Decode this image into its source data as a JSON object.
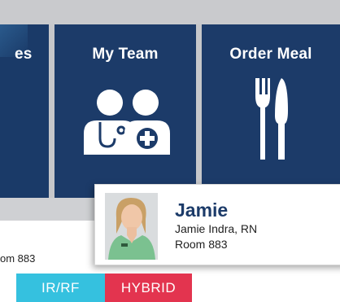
{
  "tiles": {
    "left_partial_label": "es",
    "team_label": "My Team",
    "meal_label": "Order Meal"
  },
  "left_panel": {
    "room_partial": "om 883"
  },
  "card": {
    "name": "Jamie",
    "full_name": "Jamie Indra, RN",
    "room": "Room 883"
  },
  "buttons": {
    "irrf_label": "IR/RF",
    "hybrid_label": "HYBRID"
  },
  "colors": {
    "tile_navy": "#1c3b69",
    "irrf_cyan": "#35c1df",
    "hybrid_red": "#e3344f"
  },
  "icons": [
    "care-team-icon",
    "fork-knife-icon"
  ]
}
